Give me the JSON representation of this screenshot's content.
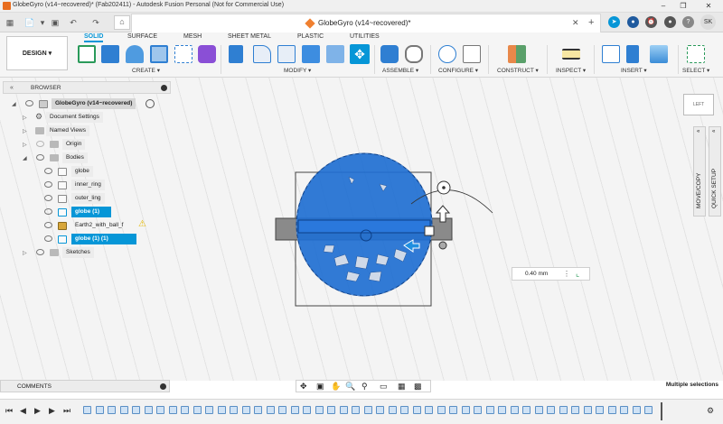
{
  "window": {
    "title": "GlobeGyro (v14~recovered)* (Fab202411) - Autodesk Fusion Personal (Not for Commercial Use)"
  },
  "tabbar": {
    "document_tab": "GlobeGyro (v14~recovered)*",
    "user_initials": "SK"
  },
  "ribbon": {
    "workspace": "DESIGN",
    "tabs": [
      "SOLID",
      "SURFACE",
      "MESH",
      "SHEET METAL",
      "PLASTIC",
      "UTILITIES"
    ],
    "groups": [
      "CREATE",
      "MODIFY",
      "ASSEMBLE",
      "CONFIGURE",
      "CONSTRUCT",
      "INSPECT",
      "INSERT",
      "SELECT"
    ]
  },
  "browser": {
    "header": "BROWSER",
    "root": "GlobeGyro (v14~recovered)",
    "items": [
      {
        "label": "Document Settings"
      },
      {
        "label": "Named Views"
      },
      {
        "label": "Origin"
      },
      {
        "label": "Bodies"
      },
      {
        "label": "globe"
      },
      {
        "label": "inner_ring"
      },
      {
        "label": "outer_ling"
      },
      {
        "label": "globe (1)"
      },
      {
        "label": "Earth2_with_ball_f"
      },
      {
        "label": "globe (1) (1)"
      },
      {
        "label": "Sketches"
      }
    ]
  },
  "viewcube": {
    "face": "LEFT"
  },
  "right_panels": [
    "MOVE/COPY",
    "QUICK SETUP"
  ],
  "manipulator": {
    "distance": "0.40 mm"
  },
  "bottom": {
    "comments": "COMMENTS",
    "status": "Multiple selections"
  },
  "colors": {
    "accent": "#0696d7",
    "selection": "#1f6fd1"
  }
}
